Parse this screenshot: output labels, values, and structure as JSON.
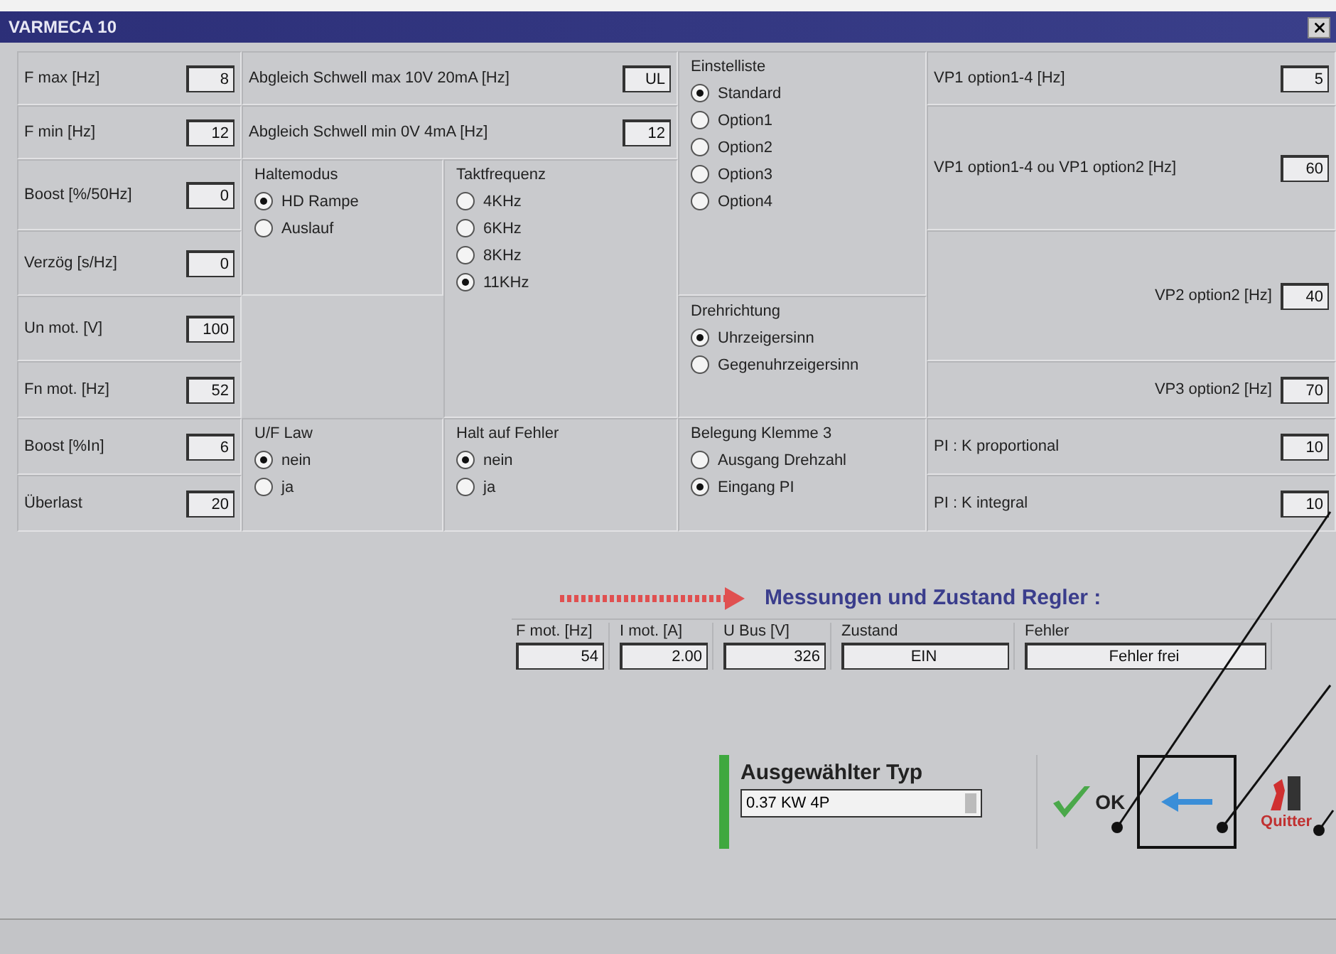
{
  "window": {
    "title": "VARMECA 10"
  },
  "limits": [
    {
      "label": "F max [Hz]",
      "value": "8"
    },
    {
      "label": "F min [Hz]",
      "value": "12"
    }
  ],
  "thresholds": [
    {
      "label": "Abgleich Schwell max 10V 20mA [Hz]",
      "value": "UL"
    },
    {
      "label": "Abgleich Schwell min 0V 4mA [Hz]",
      "value": "12"
    }
  ],
  "boost_fields": [
    {
      "label": "Boost [%/50Hz]",
      "value": "0"
    },
    {
      "label": "Verzög [s/Hz]",
      "value": "0"
    }
  ],
  "motor_fields": [
    {
      "label": "Un mot. [V]",
      "value": "100"
    },
    {
      "label": "Fn mot. [Hz]",
      "value": "52"
    },
    {
      "label": "Boost [%In]",
      "value": "6"
    },
    {
      "label": "Überlast",
      "value": "20"
    }
  ],
  "groups": [
    {
      "title": "Haltemodus",
      "options": [
        {
          "label": "HD Rampe",
          "selected": true
        },
        {
          "label": "Auslauf",
          "selected": false
        }
      ]
    },
    {
      "title": "Taktfrequenz",
      "options": [
        {
          "label": "4KHz",
          "selected": false
        },
        {
          "label": "6KHz",
          "selected": false
        },
        {
          "label": "8KHz",
          "selected": false
        },
        {
          "label": "11KHz",
          "selected": true
        }
      ]
    },
    {
      "title": "Einstelliste",
      "options": [
        {
          "label": "Standard",
          "selected": true
        },
        {
          "label": "Option1",
          "selected": false
        },
        {
          "label": "Option2",
          "selected": false
        },
        {
          "label": "Option3",
          "selected": false
        },
        {
          "label": "Option4",
          "selected": false
        }
      ]
    },
    {
      "title": "Drehrichtung",
      "options": [
        {
          "label": "Uhrzeigersinn",
          "selected": true
        },
        {
          "label": "Gegenuhrzeigersinn",
          "selected": false
        }
      ]
    },
    {
      "title": "U/F Law",
      "options": [
        {
          "label": "nein",
          "selected": true
        },
        {
          "label": "ja",
          "selected": false
        }
      ]
    },
    {
      "title": "Halt auf Fehler",
      "options": [
        {
          "label": "nein",
          "selected": true
        },
        {
          "label": "ja",
          "selected": false
        }
      ]
    },
    {
      "title": "Belegung Klemme 3",
      "options": [
        {
          "label": "Ausgang Drehzahl",
          "selected": false
        },
        {
          "label": "Eingang PI",
          "selected": true
        }
      ]
    }
  ],
  "vp_fields": [
    {
      "label": "VP1 option1-4 [Hz]",
      "value": "5"
    },
    {
      "label": "VP1 option1-4 ou VP1 option2 [Hz]",
      "value": "60"
    },
    {
      "label": "VP2 option2 [Hz]",
      "value": "40"
    },
    {
      "label": "VP3 option2 [Hz]",
      "value": "70"
    }
  ],
  "pi_fields": [
    {
      "label": "PI : K proportional",
      "value": "10"
    },
    {
      "label": "PI : K integral",
      "value": "10"
    }
  ],
  "measurements": {
    "title": "Messungen und Zustand Regler :",
    "columns": [
      {
        "label": "F mot. [Hz]",
        "value": "54"
      },
      {
        "label": "I mot. [A]",
        "value": "2.00"
      },
      {
        "label": "U Bus [V]",
        "value": "326"
      },
      {
        "label": "Zustand",
        "value": "EIN"
      },
      {
        "label": "Fehler",
        "value": "Fehler frei"
      }
    ]
  },
  "type_panel": {
    "label": "Ausgewählter Typ",
    "value": "0.37 KW 4P"
  },
  "buttons": [
    {
      "kind": "ok",
      "label": "OK"
    },
    {
      "kind": "back"
    },
    {
      "kind": "quit",
      "label": "Quitter"
    }
  ]
}
